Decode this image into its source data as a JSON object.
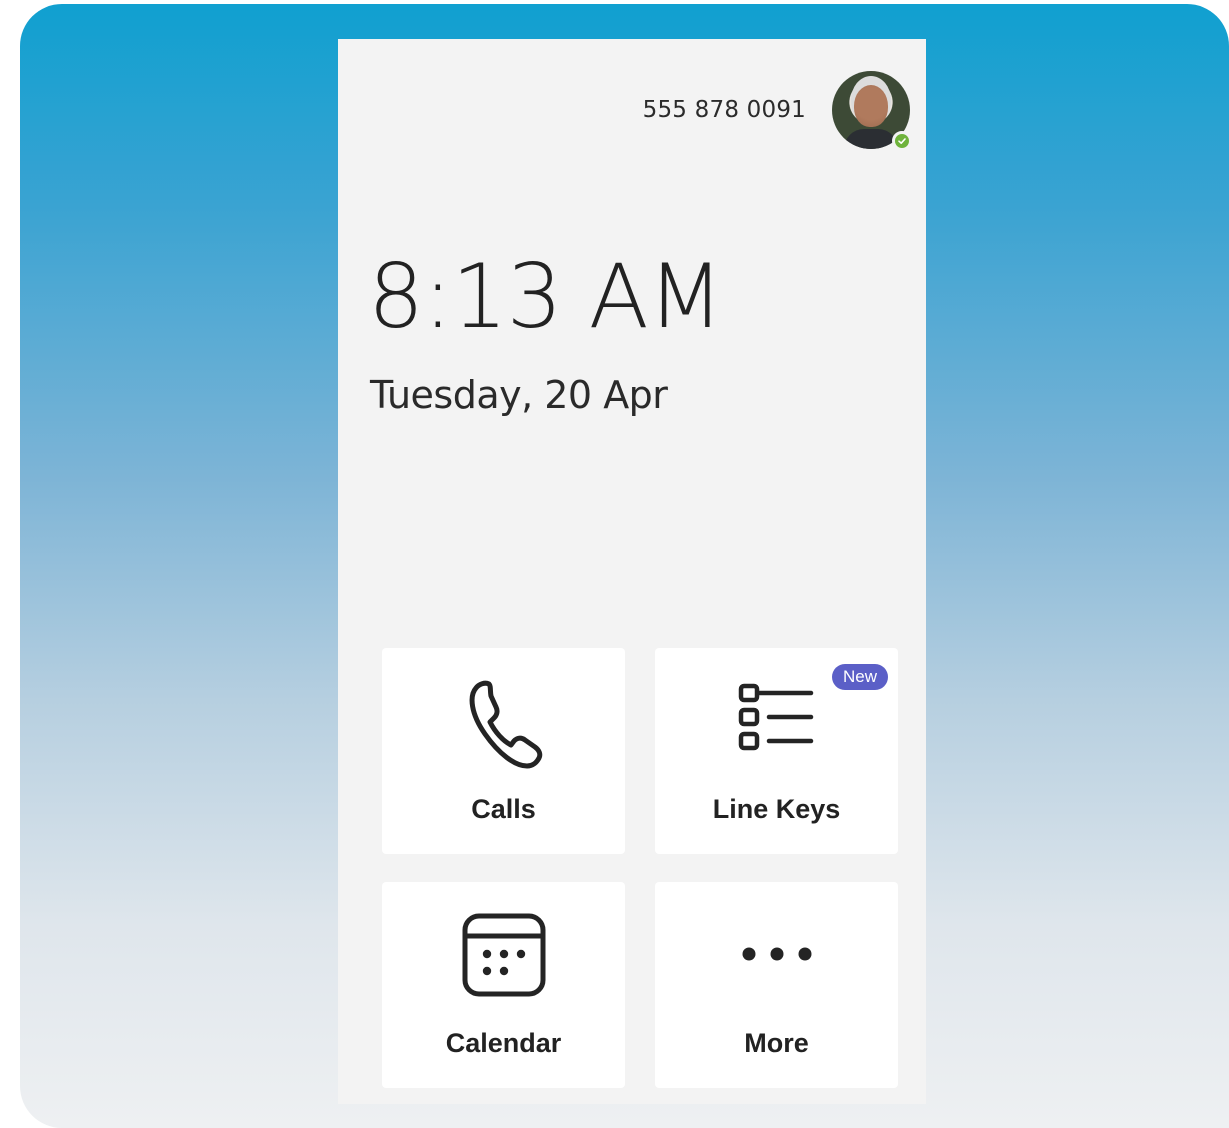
{
  "header": {
    "phone_number": "555 878 0091",
    "presence_color": "#6fb33c"
  },
  "clock": {
    "time": "8:13 AM",
    "date": "Tuesday, 20 Apr"
  },
  "tiles": [
    {
      "label": "Calls",
      "icon": "phone-icon"
    },
    {
      "label": "Line Keys",
      "icon": "line-keys-icon",
      "badge": "New"
    },
    {
      "label": "Calendar",
      "icon": "calendar-icon"
    },
    {
      "label": "More",
      "icon": "more-icon"
    }
  ],
  "colors": {
    "badge": "#5b5fc7",
    "background_top": "#10a0d0",
    "background_bottom": "#eef0f2"
  }
}
